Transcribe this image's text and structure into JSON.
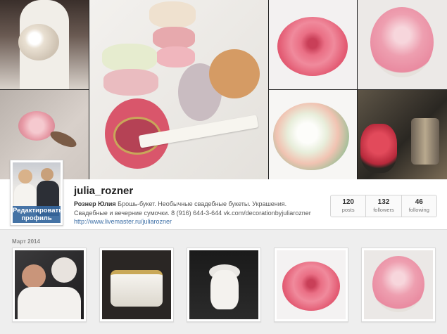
{
  "profile": {
    "username": "julia_rozner",
    "name": "Рознер Юлия",
    "bio_line1": "Брошь-букет. Необычные свадебные букеты. Украшения.",
    "bio_line2": "Свадебные и вечерние сумочки. 8 (916) 644-3-644 vk.com/decorationbyjuliarozner",
    "website": "http://www.livemaster.ru/juliarozner",
    "edit_button": "Редактировать\nпрофиль"
  },
  "stats": [
    {
      "value": "120",
      "label": "posts"
    },
    {
      "value": "132",
      "label": "followers"
    },
    {
      "value": "46",
      "label": "following"
    }
  ],
  "section": {
    "date_label": "Март 2014"
  },
  "posts": [
    {
      "subject": "couple-with-dog"
    },
    {
      "subject": "white-clutch"
    },
    {
      "subject": "white-dog"
    },
    {
      "subject": "rose-bag"
    },
    {
      "subject": "rose-bouquet"
    }
  ],
  "colors": {
    "link": "#3d6fa6",
    "edit_button_bg": "#3668a0",
    "background": "#eeeeee"
  }
}
